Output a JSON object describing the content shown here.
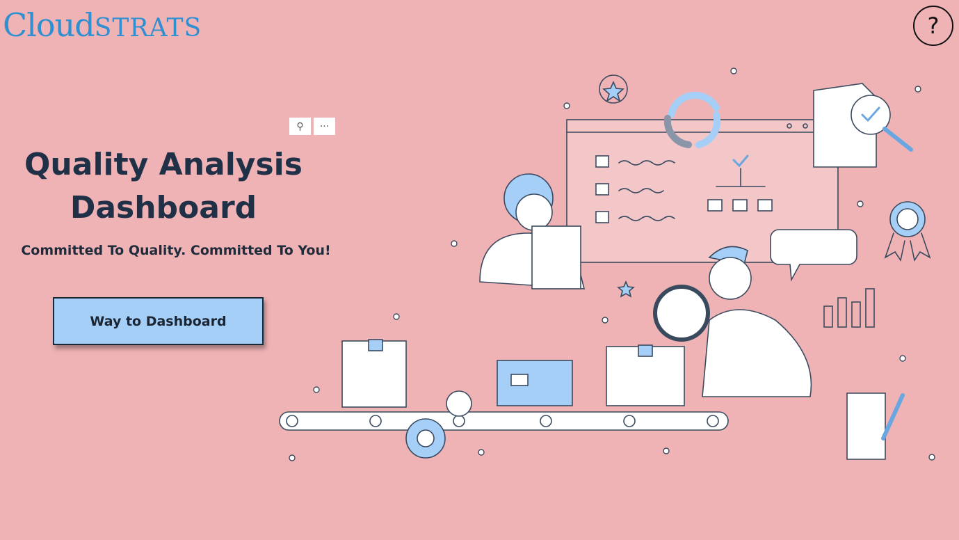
{
  "brand": {
    "logo_main": "Cloud",
    "logo_suffix": "STRATS"
  },
  "header": {
    "help_symbol": "?"
  },
  "visual_header": {
    "pin_symbol": "⚲",
    "more_symbol": "···"
  },
  "hero": {
    "title_line1": "Quality Analysis",
    "title_line2": "Dashboard",
    "tagline": "Committed To Quality. Committed To You!",
    "cta_label": "Way to Dashboard"
  },
  "colors": {
    "background": "#efb3b6",
    "accent_blue": "#a6cff8",
    "title_navy": "#1f3047",
    "logo_blue": "#2f8fd0"
  },
  "icons": [
    "help-icon",
    "pin-icon",
    "more-options-icon",
    "quality-inspection-illustration"
  ]
}
